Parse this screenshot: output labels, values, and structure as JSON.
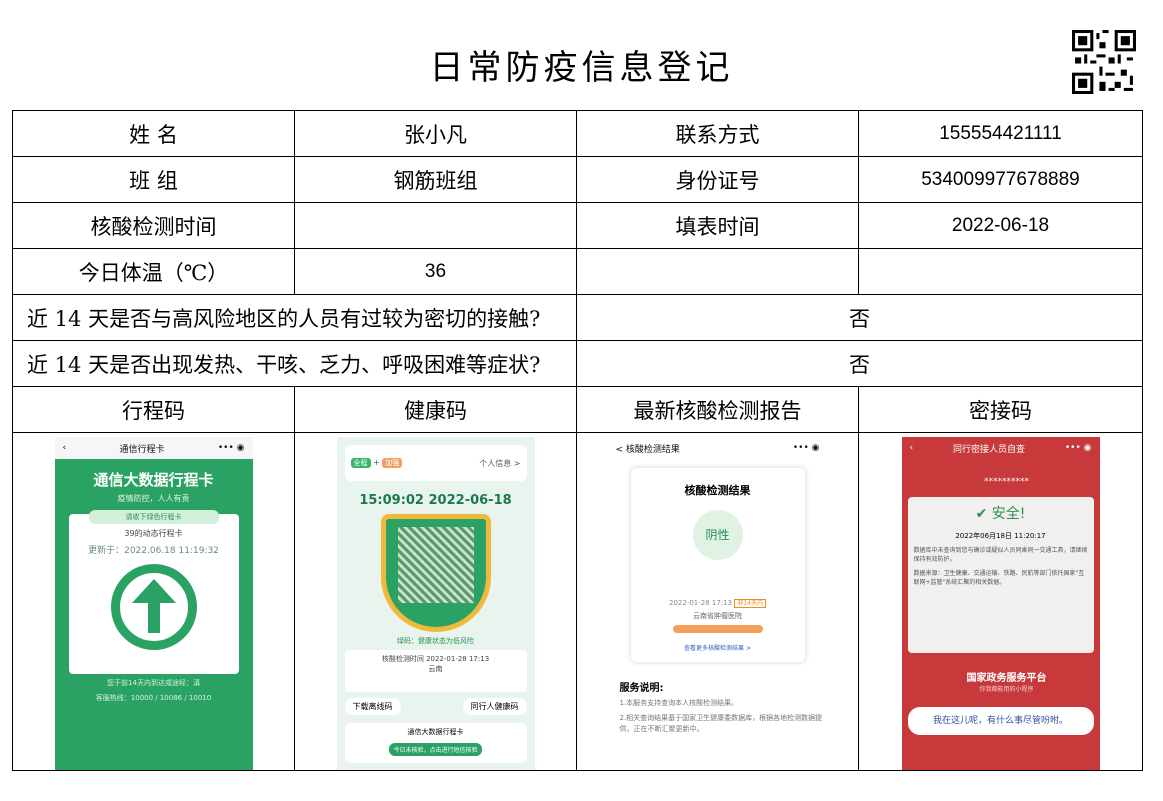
{
  "title": "日常防疫信息登记",
  "rows": {
    "name_label": "姓 名",
    "name_value": "张小凡",
    "contact_label": "联系方式",
    "contact_value": "155554421111",
    "team_label": "班 组",
    "team_value": "钢筋班组",
    "id_label": "身份证号",
    "id_value": "534009977678889",
    "test_time_label": "核酸检测时间",
    "test_time_value": "",
    "fill_time_label": "填表时间",
    "fill_time_value": "2022-06-18",
    "temp_label": "今日体温（℃）",
    "temp_value": "36",
    "q1": "近 14 天是否与高风险地区的人员有过较为密切的接触?",
    "q1_answer": "否",
    "q2": "近 14 天是否出现发热、干咳、乏力、呼吸困难等症状?",
    "q2_answer": "否"
  },
  "codes_header": [
    "行程码",
    "健康码",
    "最新核酸检测报告",
    "密接码"
  ],
  "trip": {
    "bar_title": "通信行程卡",
    "title": "通信大数据行程卡",
    "subtitle": "疫情防控，人人有责",
    "pill": "请收下绿色行程卡",
    "card_line": "39的动态行程卡",
    "updated": "更新于：2022.06.18 11:19:32",
    "visited": "您于前14天内到达或途经：滇",
    "hotline": "客服热线：10000 / 10086 / 10010"
  },
  "health": {
    "tag_full": "全程",
    "tag_boost": "加强",
    "personal": "个人信息 >",
    "time": "15:09:02  2022-06-18",
    "status": "绿码：健康状态为低风险",
    "test_time": "核酸检测时间    2022-01-28 17:13",
    "place": "云南",
    "btn1": "下载离线码",
    "btn2": "同行人健康码",
    "trip_card": "通信大数据行程卡",
    "trip_btn": "今日未核验，点击进行短信核验"
  },
  "nucleic": {
    "bar_title": "< 核酸检测结果",
    "card_title": "核酸检测结果",
    "result": "阴性",
    "date": "2022-01-28 17:13",
    "badge": "非14天内",
    "hospital": "云南省肿瘤医院",
    "more": "查看更多核酸检测结果 >",
    "service_title": "服务说明:",
    "service_1": "1.本服务支持查询本人核酸检测结果。",
    "service_2": "2.相关查询结果基于国家卫生健康委数据库，根据各地检测数据提供，正在不断汇聚更新中。"
  },
  "contact": {
    "bar_title": "同行密接人员自查",
    "stars": "**********",
    "safe": "安全!",
    "datetime": "2022年06月18日 11:20:17",
    "desc": "数据库中未查询到您与确诊或疑似人员同乘同一交通工具，请继续保持有效防护。",
    "source": "数据来源：卫生健康、交通运输、铁路、民航等部门依托国家\"互联网+监管\"系统汇聚的相关数据。",
    "gov": "国家政务服务平台",
    "gov_sub": "你我都能用的小程序",
    "ask": "我在这儿呢，有什么事尽管吩咐。"
  }
}
